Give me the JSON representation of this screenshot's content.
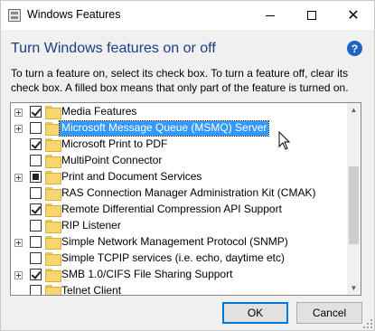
{
  "window": {
    "title": "Windows Features"
  },
  "header": {
    "heading": "Turn Windows features on or off",
    "help_symbol": "?",
    "description": "To turn a feature on, select its check box. To turn a feature off, clear its check box. A filled box means that only part of the feature is turned on."
  },
  "features": [
    {
      "label": "Media Features",
      "state": "checked",
      "expandable": true,
      "selected": false
    },
    {
      "label": "Microsoft Message Queue (MSMQ) Server",
      "state": "unchecked",
      "expandable": true,
      "selected": true
    },
    {
      "label": "Microsoft Print to PDF",
      "state": "checked",
      "expandable": false,
      "selected": false
    },
    {
      "label": "MultiPoint Connector",
      "state": "unchecked",
      "expandable": false,
      "selected": false
    },
    {
      "label": "Print and Document Services",
      "state": "partial",
      "expandable": true,
      "selected": false
    },
    {
      "label": "RAS Connection Manager Administration Kit (CMAK)",
      "state": "unchecked",
      "expandable": false,
      "selected": false
    },
    {
      "label": "Remote Differential Compression API Support",
      "state": "checked",
      "expandable": false,
      "selected": false
    },
    {
      "label": "RIP Listener",
      "state": "unchecked",
      "expandable": false,
      "selected": false
    },
    {
      "label": "Simple Network Management Protocol (SNMP)",
      "state": "unchecked",
      "expandable": true,
      "selected": false
    },
    {
      "label": "Simple TCPIP services (i.e. echo, daytime etc)",
      "state": "unchecked",
      "expandable": false,
      "selected": false
    },
    {
      "label": "SMB 1.0/CIFS File Sharing Support",
      "state": "checked",
      "expandable": true,
      "selected": false
    },
    {
      "label": "Telnet Client",
      "state": "unchecked",
      "expandable": false,
      "selected": false
    }
  ],
  "buttons": {
    "ok": "OK",
    "cancel": "Cancel"
  },
  "colors": {
    "heading": "#1a3e8a",
    "selection": "#3399ff",
    "help_icon": "#1f63c4",
    "default_button_border": "#0078d7"
  }
}
